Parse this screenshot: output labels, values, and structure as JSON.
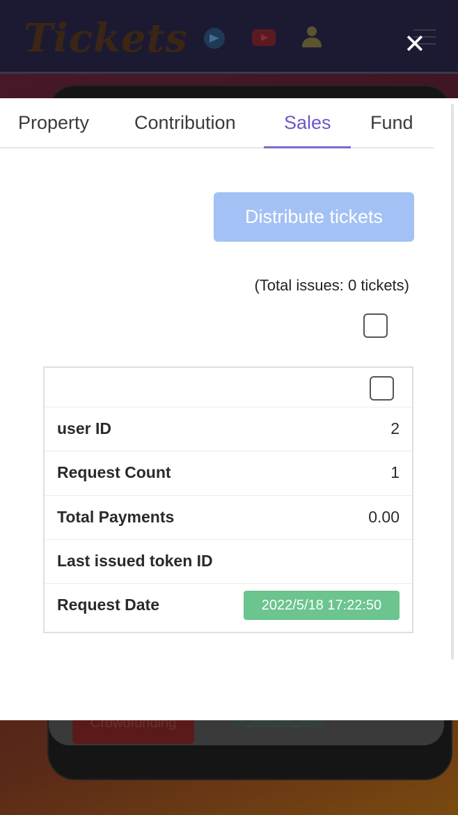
{
  "background": {
    "logo_text": "Tickets",
    "crowdfunding_label": "Crowdfunding",
    "official_link": "@_official_dsp"
  },
  "close_label": "✕",
  "tabs": [
    {
      "label": "Property",
      "active": false
    },
    {
      "label": "Contribution",
      "active": false
    },
    {
      "label": "Sales",
      "active": true
    },
    {
      "label": "Fund",
      "active": false
    }
  ],
  "actions": {
    "distribute_label": "Distribute tickets"
  },
  "summary": {
    "total_issues": "(Total issues: 0 tickets)"
  },
  "record": {
    "user_id_label": "user ID",
    "user_id_value": "2",
    "request_count_label": "Request Count",
    "request_count_value": "1",
    "total_payments_label": "Total Payments",
    "total_payments_value": "0.00",
    "last_token_label": "Last issued token ID",
    "last_token_value": "",
    "request_date_label": "Request Date",
    "request_date_value": "2022/5/18 17:22:50"
  },
  "colors": {
    "accent": "#6f56c6",
    "button_disabled": "#a3c1f4",
    "date_badge": "#6cc48e",
    "header_bg": "#1c1a33"
  }
}
